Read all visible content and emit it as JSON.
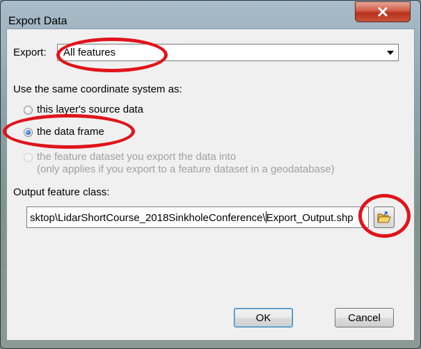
{
  "window": {
    "title": "Export Data",
    "close_symbol": "x"
  },
  "export": {
    "label": "Export:",
    "selected": "All features"
  },
  "coordinate": {
    "heading": "Use the same coordinate system as:",
    "options": [
      {
        "label": "this layer's source data",
        "checked": false,
        "enabled": true
      },
      {
        "label": "the data frame",
        "checked": true,
        "enabled": true
      },
      {
        "label": "the feature dataset you export the data into",
        "note": "(only applies if you export to a feature dataset in a geodatabase)",
        "checked": false,
        "enabled": false
      }
    ]
  },
  "output": {
    "label": "Output feature class:",
    "value_before_caret": "sktop\\LidarShortCourse_2018SinkholeConference\\",
    "value_after_caret": "Export_Output.shp"
  },
  "buttons": {
    "ok": "OK",
    "cancel": "Cancel"
  },
  "icons": {
    "close": "close-icon",
    "dropdown": "chevron-down-icon",
    "browse": "folder-open-icon"
  },
  "colors": {
    "annotation": "#e0141b",
    "close_button": "#c8553a"
  }
}
